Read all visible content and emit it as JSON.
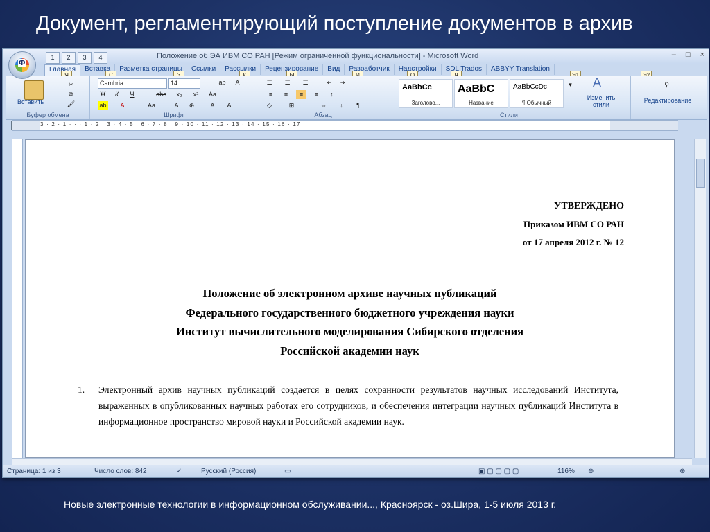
{
  "slide": {
    "title": "Документ, регламентирующий поступление документов в архив",
    "footer": "Новые электронные технологии в информационном обслуживании..., Красноярск - оз.Шира,  1-5 июля 2013 г."
  },
  "window": {
    "title": "Положение об ЭА ИВМ СО РАН [Режим ограниченной функциональности] - Microsoft Word",
    "office_keytip": "Ф",
    "qat": [
      "1",
      "2",
      "3",
      "4"
    ],
    "controls": [
      "–",
      "□",
      "×"
    ]
  },
  "tabs": [
    "Главная",
    "Вставка",
    "Разметка страницы",
    "Ссылки",
    "Рассылки",
    "Рецензирование",
    "Вид",
    "Разработчик",
    "Надстройки",
    "SDL Trados",
    "ABBYY Translation"
  ],
  "keytips": [
    "Я",
    "С",
    "З",
    "К",
    "Ы",
    "И",
    "О",
    "Ч",
    "Э1",
    "Э2"
  ],
  "ribbon": {
    "clipboard": {
      "paste": "Вставить",
      "label": "Буфер обмена"
    },
    "font": {
      "name": "Cambria",
      "size": "14",
      "label": "Шрифт"
    },
    "paragraph": {
      "label": "Абзац"
    },
    "styles": {
      "label": "Стили",
      "items": [
        {
          "preview": "AaBbCc",
          "name": "Заголово..."
        },
        {
          "preview": "AaBbC",
          "name": "Название"
        },
        {
          "preview": "AaBbCcDc",
          "name": "¶ Обычный"
        }
      ],
      "change": "Изменить стили"
    },
    "editing": {
      "label": "Редактирование"
    }
  },
  "ruler": {
    "numbers": "3 · 2 · 1 · · · 1 · 2 · 3 · 4 · 5 · 6 · 7 · 8 · 9 · 10 · 11 · 12 · 13 · 14 · 15 · 16 · 17"
  },
  "document": {
    "approve": [
      "УТВЕРЖДЕНО",
      "Приказом ИВМ СО РАН",
      "от 17 апреля 2012 г. № 12"
    ],
    "heading": [
      "Положение об электронном архиве научных публикаций",
      "Федерального государственного бюджетного учреждения науки",
      "Институт вычислительного моделирования Сибирского отделения",
      "Российской академии наук"
    ],
    "item_number": "1.",
    "item_text": "Электронный архив научных публикаций создается в целях сохранности результатов научных исследований Института, выраженных в опубликованных научных работах его сотрудников, и обеспечения интеграции научных публикаций Института в информационное пространство мировой науки и Российской академии наук."
  },
  "status": {
    "page": "Страница: 1 из 3",
    "words": "Число слов: 842",
    "language": "Русский (Россия)",
    "zoom": "116%"
  }
}
